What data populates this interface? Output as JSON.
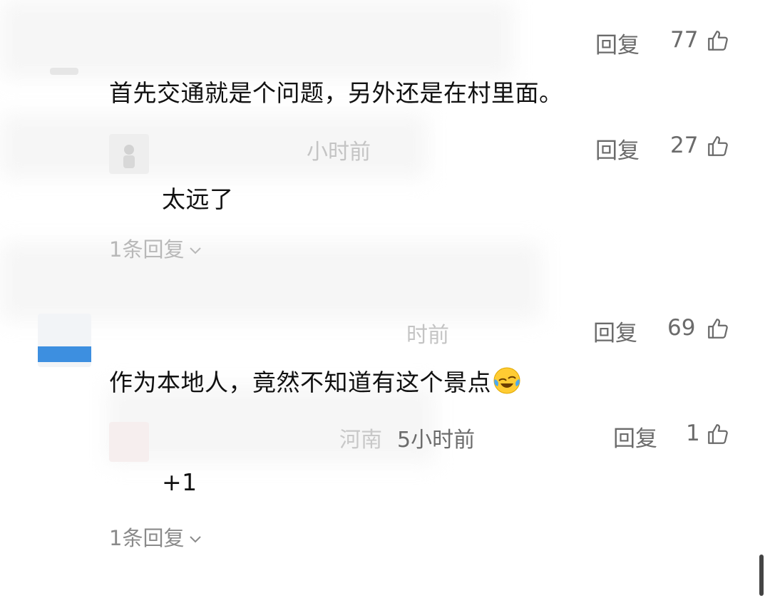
{
  "comments": [
    {
      "reply_label": "回复",
      "likes": "77",
      "text": "首先交通就是个问题，另外还是在村里面。"
    },
    {
      "time": "小时前",
      "reply_label": "回复",
      "likes": "27",
      "text": "太远了",
      "more_replies": "1条回复"
    },
    {
      "time": "时前",
      "reply_label": "回复",
      "likes": "69",
      "text": "作为本地人，竟然不知道有这个景点",
      "emoji_icon": "grinning-tears-emoji"
    },
    {
      "location": "河南",
      "time": "5小时前",
      "reply_label": "回复",
      "likes": "1",
      "text": "+1",
      "more_replies": "1条回复"
    }
  ],
  "icons": {
    "like": "thumbs-up-icon",
    "expand": "chevron-down-icon"
  },
  "colors": {
    "text": "#111111",
    "secondary": "#6b6b6b",
    "muted": "#8a8a8a",
    "avatar_blue": "#3d8fe0"
  }
}
